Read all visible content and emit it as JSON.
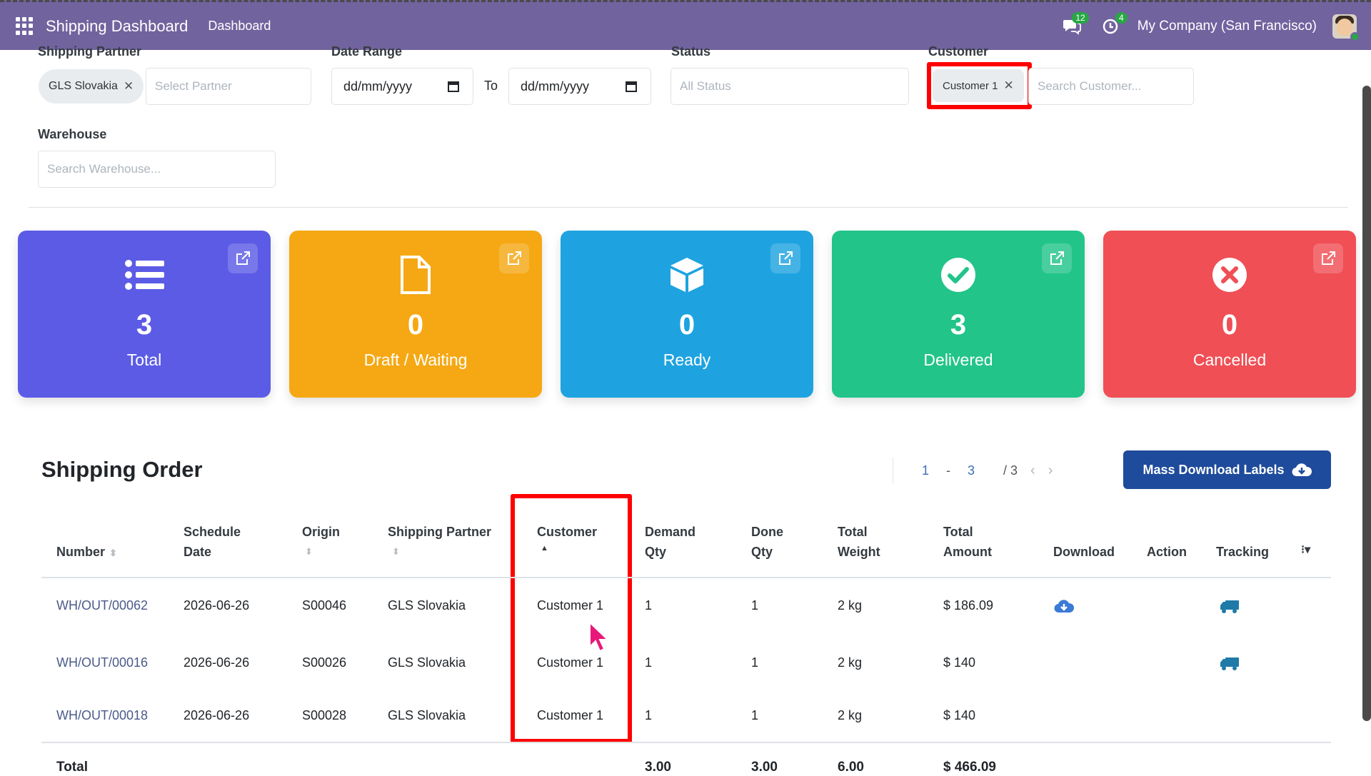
{
  "navbar": {
    "app_title": "Shipping Dashboard",
    "menu_item": "Dashboard",
    "messages_badge": "12",
    "activities_badge": "4",
    "company": "My Company (San Francisco)"
  },
  "filters": {
    "shipping_partner": {
      "label": "Shipping Partner",
      "chip": "GLS Slovakia",
      "placeholder": "Select Partner"
    },
    "date_range": {
      "label": "Date Range",
      "from": "dd/mm/yyyy",
      "to_label": "To",
      "to": "dd/mm/yyyy"
    },
    "status": {
      "label": "Status",
      "placeholder": "All Status"
    },
    "customer": {
      "label": "Customer",
      "chip": "Customer 1",
      "placeholder": "Search Customer..."
    },
    "warehouse": {
      "label": "Warehouse",
      "placeholder": "Search Warehouse..."
    }
  },
  "cards": [
    {
      "value": "3",
      "label": "Total",
      "icon": "list-icon",
      "color": "#5b5be6"
    },
    {
      "value": "0",
      "label": "Draft / Waiting",
      "icon": "file-icon",
      "color": "#f5a814"
    },
    {
      "value": "0",
      "label": "Ready",
      "icon": "box-icon",
      "color": "#1ea3e0"
    },
    {
      "value": "3",
      "label": "Delivered",
      "icon": "check-circle-icon",
      "color": "#22c48a"
    },
    {
      "value": "0",
      "label": "Cancelled",
      "icon": "x-circle-icon",
      "color": "#ef4f55"
    }
  ],
  "orders": {
    "title": "Shipping Order",
    "pager": {
      "start": "1",
      "dash": "-",
      "end": "3",
      "total": "/ 3"
    },
    "mass_download_label": "Mass Download Labels",
    "columns": {
      "number": "Number",
      "schedule_1": "Schedule",
      "schedule_2": "Date",
      "origin": "Origin",
      "partner": "Shipping Partner",
      "customer": "Customer",
      "demand_1": "Demand",
      "demand_2": "Qty",
      "done_1": "Done",
      "done_2": "Qty",
      "weight_1": "Total",
      "weight_2": "Weight",
      "amount_1": "Total",
      "amount_2": "Amount",
      "download": "Download",
      "action": "Action",
      "tracking": "Tracking"
    },
    "rows": [
      {
        "number": "WH/OUT/00062",
        "date": "2026-06-26",
        "origin": "S00046",
        "partner": "GLS Slovakia",
        "customer": "Customer 1",
        "demand": "1",
        "done": "1",
        "weight": "2 kg",
        "amount": "$ 186.09"
      },
      {
        "number": "WH/OUT/00016",
        "date": "2026-06-26",
        "origin": "S00026",
        "partner": "GLS Slovakia",
        "customer": "Customer 1",
        "demand": "1",
        "done": "1",
        "weight": "2 kg",
        "amount": "$ 140"
      },
      {
        "number": "WH/OUT/00018",
        "date": "2026-06-26",
        "origin": "S00028",
        "partner": "GLS Slovakia",
        "customer": "Customer 1",
        "demand": "1",
        "done": "1",
        "weight": "2 kg",
        "amount": "$ 140"
      }
    ],
    "footer": {
      "label": "Total",
      "demand": "3.00",
      "done": "3.00",
      "weight": "6.00",
      "amount": "$ 466.09"
    }
  }
}
